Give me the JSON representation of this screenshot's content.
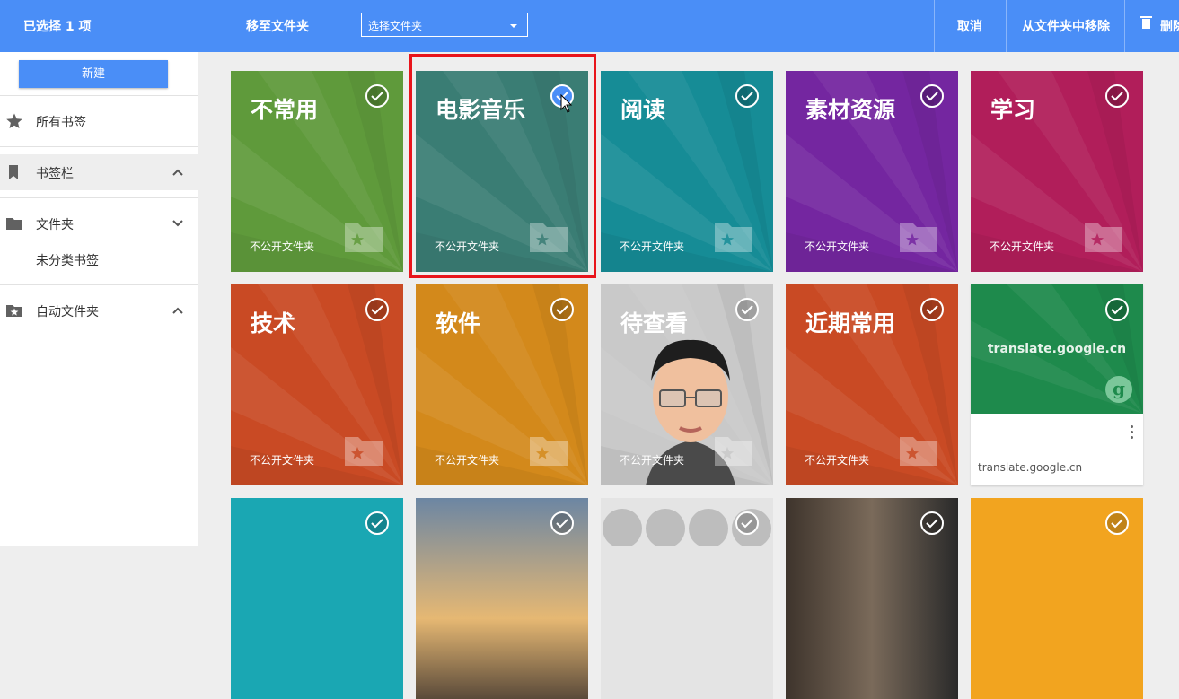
{
  "topbar": {
    "selected_count": "已选择 1 项",
    "move_to_label": "移至文件夹",
    "folder_select_value": "选择文件夹",
    "cancel": "取消",
    "remove_from_folder": "从文件夹中移除",
    "delete": "删除"
  },
  "sidebar": {
    "new_button": "新建",
    "all_bookmarks": "所有书签",
    "bookmarks_bar": "书签栏",
    "folders": "文件夹",
    "uncategorized": "未分类书签",
    "auto_folders": "自动文件夹"
  },
  "tiles": [
    {
      "title": "不常用",
      "subtitle": "不公开文件夹",
      "color": "#5f9a3b",
      "checked": false
    },
    {
      "title": "电影音乐",
      "subtitle": "不公开文件夹",
      "color": "#3a7d74",
      "checked": true
    },
    {
      "title": "阅读",
      "subtitle": "不公开文件夹",
      "color": "#168c96",
      "checked": false
    },
    {
      "title": "素材资源",
      "subtitle": "不公开文件夹",
      "color": "#7426a0",
      "checked": false
    },
    {
      "title": "学习",
      "subtitle": "不公开文件夹",
      "color": "#b11e5a",
      "checked": false
    },
    {
      "title": "技术",
      "subtitle": "不公开文件夹",
      "color": "#c94a24",
      "checked": false
    },
    {
      "title": "软件",
      "subtitle": "不公开文件夹",
      "color": "#d3891b",
      "checked": false
    },
    {
      "title": "待查看",
      "subtitle": "不公开文件夹",
      "color": "#c9c9c9",
      "checked": false
    },
    {
      "title": "近期常用",
      "subtitle": "不公开文件夹",
      "color": "#c94a24",
      "checked": false
    }
  ],
  "google_card": {
    "site": "translate.google.cn",
    "icon_letter": "g",
    "footer": "translate.google.cn"
  }
}
